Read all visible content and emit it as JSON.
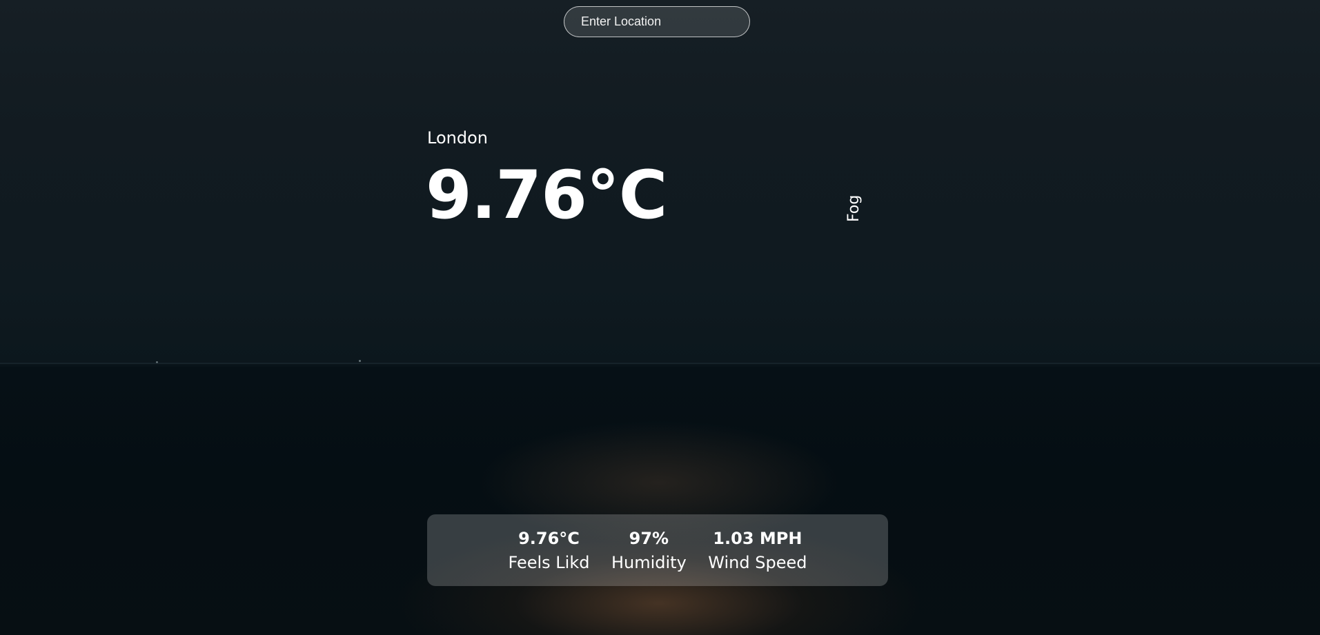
{
  "search": {
    "placeholder": "Enter Location",
    "value": ""
  },
  "current": {
    "location": "London",
    "temperature": "9.76°C",
    "description": "Fog"
  },
  "stats": [
    {
      "value": "9.76°C",
      "label": "Feels Likd"
    },
    {
      "value": "97%",
      "label": "Humidity"
    },
    {
      "value": "1.03 MPH",
      "label": "Wind Speed"
    }
  ]
}
